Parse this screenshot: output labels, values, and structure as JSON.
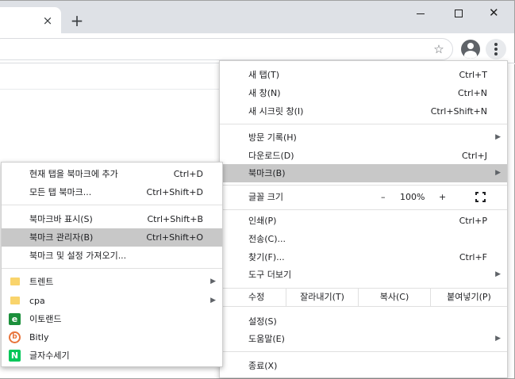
{
  "window": {
    "tab_close_glyph": "×",
    "new_tab_glyph": "+",
    "close_glyph": "✕",
    "star_glyph": "☆"
  },
  "menu": {
    "items": [
      {
        "label": "새 탭(T)",
        "shortcut": "Ctrl+T"
      },
      {
        "label": "새 창(N)",
        "shortcut": "Ctrl+N"
      },
      {
        "label": "새 시크릿 창(I)",
        "shortcut": "Ctrl+Shift+N"
      },
      {
        "label": "방문 기록(H)",
        "shortcut": ""
      },
      {
        "label": "다운로드(D)",
        "shortcut": "Ctrl+J"
      },
      {
        "label": "북마크(B)",
        "shortcut": ""
      },
      {
        "label": "글꼴 크기",
        "shortcut": ""
      },
      {
        "label": "인쇄(P)",
        "shortcut": "Ctrl+P"
      },
      {
        "label": "전송(C)...",
        "shortcut": ""
      },
      {
        "label": "찾기(F)...",
        "shortcut": "Ctrl+F"
      },
      {
        "label": "도구 더보기",
        "shortcut": ""
      },
      {
        "label": "설정(S)",
        "shortcut": ""
      },
      {
        "label": "도움말(E)",
        "shortcut": ""
      },
      {
        "label": "종료(X)",
        "shortcut": ""
      }
    ],
    "zoom": {
      "minus": "–",
      "value": "100%",
      "plus": "+"
    },
    "edit": {
      "label": "수정",
      "cut": "잘라내기(T)",
      "copy": "복사(C)",
      "paste": "붙여넣기(P)"
    },
    "arrow_glyph": "▶"
  },
  "bookmarks_submenu": {
    "items": [
      {
        "label": "현재 탭을 북마크에 추가",
        "shortcut": "Ctrl+D"
      },
      {
        "label": "모든 탭 북마크...",
        "shortcut": "Ctrl+Shift+D"
      },
      {
        "label": "북마크바 표시(S)",
        "shortcut": "Ctrl+Shift+B"
      },
      {
        "label": "북마크 관리자(B)",
        "shortcut": "Ctrl+Shift+O"
      },
      {
        "label": "북마크 및 설정 가져오기...",
        "shortcut": ""
      }
    ],
    "folders": [
      {
        "label": "트렌트"
      },
      {
        "label": "cpa"
      }
    ],
    "sites": [
      {
        "label": "이토랜드",
        "glyph": "e"
      },
      {
        "label": "Bitly",
        "glyph": "b"
      },
      {
        "label": "글자수세기",
        "glyph": "N"
      }
    ]
  }
}
